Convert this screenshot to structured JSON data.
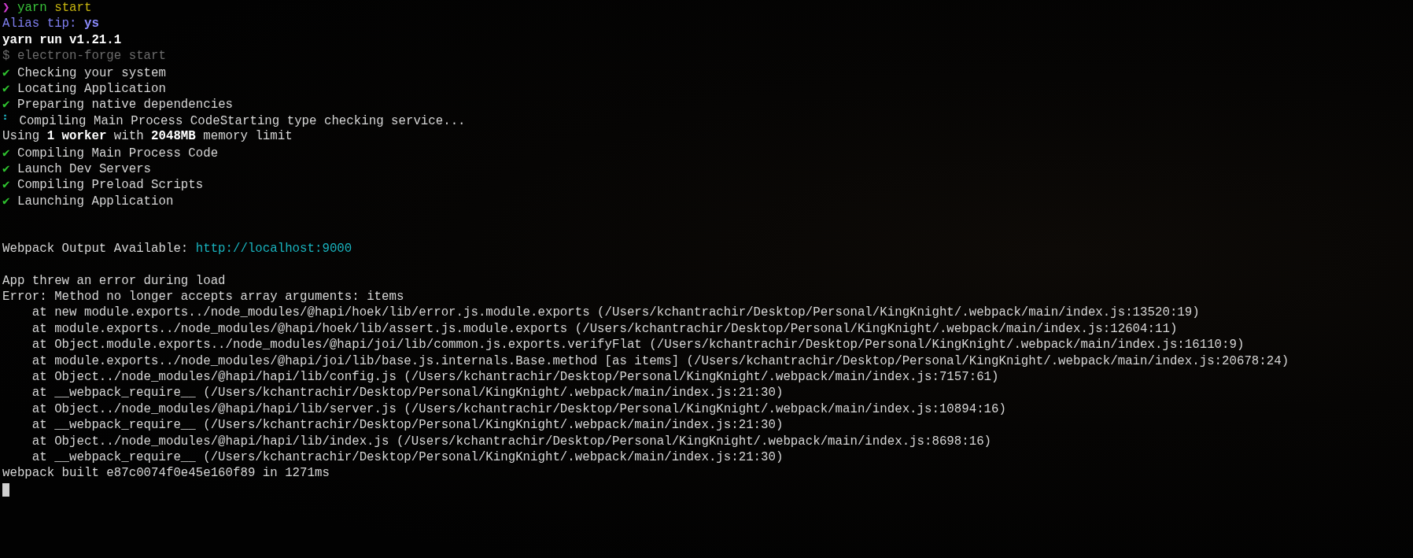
{
  "terminal": {
    "lines": [
      {
        "kind": "prompt",
        "symbol": "❯",
        "command": "yarn",
        "argument": "start"
      },
      {
        "kind": "hint",
        "text": "Alias tip: **ys**"
      },
      {
        "kind": "heading",
        "text": "yarn run v1.21.1"
      },
      {
        "kind": "dim",
        "text": "$ electron-forge start"
      },
      {
        "kind": "check",
        "mark": "✔",
        "text": "Checking your system"
      },
      {
        "kind": "check",
        "mark": "✔",
        "text": "Locating Application"
      },
      {
        "kind": "check",
        "mark": "✔",
        "text": "Preparing native dependencies"
      },
      {
        "kind": "spinner",
        "mark": "⠃",
        "text": "Compiling Main Process CodeStarting type checking service..."
      },
      {
        "kind": "text",
        "text": "Using **1 worker** with **2048MB** memory limit"
      },
      {
        "kind": "check",
        "mark": "✔",
        "text": "Compiling Main Process Code"
      },
      {
        "kind": "check",
        "mark": "✔",
        "text": "Launch Dev Servers"
      },
      {
        "kind": "check",
        "mark": "✔",
        "text": "Compiling Preload Scripts"
      },
      {
        "kind": "check",
        "mark": "✔",
        "text": "Launching Application"
      },
      {
        "kind": "blank"
      },
      {
        "kind": "blank"
      },
      {
        "kind": "link",
        "text": "Webpack Output Available: ",
        "link": "http://localhost:9000"
      },
      {
        "kind": "blank"
      },
      {
        "kind": "text",
        "text": "App threw an error during load"
      },
      {
        "kind": "text",
        "text": "Error: Method no longer accepts array arguments: items"
      },
      {
        "kind": "stack",
        "text": "at new module.exports../node_modules/@hapi/hoek/lib/error.js.module.exports (/Users/kchantrachir/Desktop/Personal/KingKnight/.webpack/main/index.js:13520:19)"
      },
      {
        "kind": "stack",
        "text": "at module.exports../node_modules/@hapi/hoek/lib/assert.js.module.exports (/Users/kchantrachir/Desktop/Personal/KingKnight/.webpack/main/index.js:12604:11)"
      },
      {
        "kind": "stack",
        "text": "at Object.module.exports../node_modules/@hapi/joi/lib/common.js.exports.verifyFlat (/Users/kchantrachir/Desktop/Personal/KingKnight/.webpack/main/index.js:16110:9)"
      },
      {
        "kind": "stack",
        "text": "at module.exports../node_modules/@hapi/joi/lib/base.js.internals.Base.method [as items] (/Users/kchantrachir/Desktop/Personal/KingKnight/.webpack/main/index.js:20678:24)"
      },
      {
        "kind": "stack",
        "text": "at Object../node_modules/@hapi/hapi/lib/config.js (/Users/kchantrachir/Desktop/Personal/KingKnight/.webpack/main/index.js:7157:61)"
      },
      {
        "kind": "stack",
        "text": "at __webpack_require__ (/Users/kchantrachir/Desktop/Personal/KingKnight/.webpack/main/index.js:21:30)"
      },
      {
        "kind": "stack",
        "text": "at Object../node_modules/@hapi/hapi/lib/server.js (/Users/kchantrachir/Desktop/Personal/KingKnight/.webpack/main/index.js:10894:16)"
      },
      {
        "kind": "stack",
        "text": "at __webpack_require__ (/Users/kchantrachir/Desktop/Personal/KingKnight/.webpack/main/index.js:21:30)"
      },
      {
        "kind": "stack",
        "text": "at Object../node_modules/@hapi/hapi/lib/index.js (/Users/kchantrachir/Desktop/Personal/KingKnight/.webpack/main/index.js:8698:16)"
      },
      {
        "kind": "stack",
        "text": "at __webpack_require__ (/Users/kchantrachir/Desktop/Personal/KingKnight/.webpack/main/index.js:21:30)"
      },
      {
        "kind": "text",
        "text": "webpack built e87c0074f0e45e160f89 in 1271ms"
      },
      {
        "kind": "cursor"
      }
    ]
  }
}
